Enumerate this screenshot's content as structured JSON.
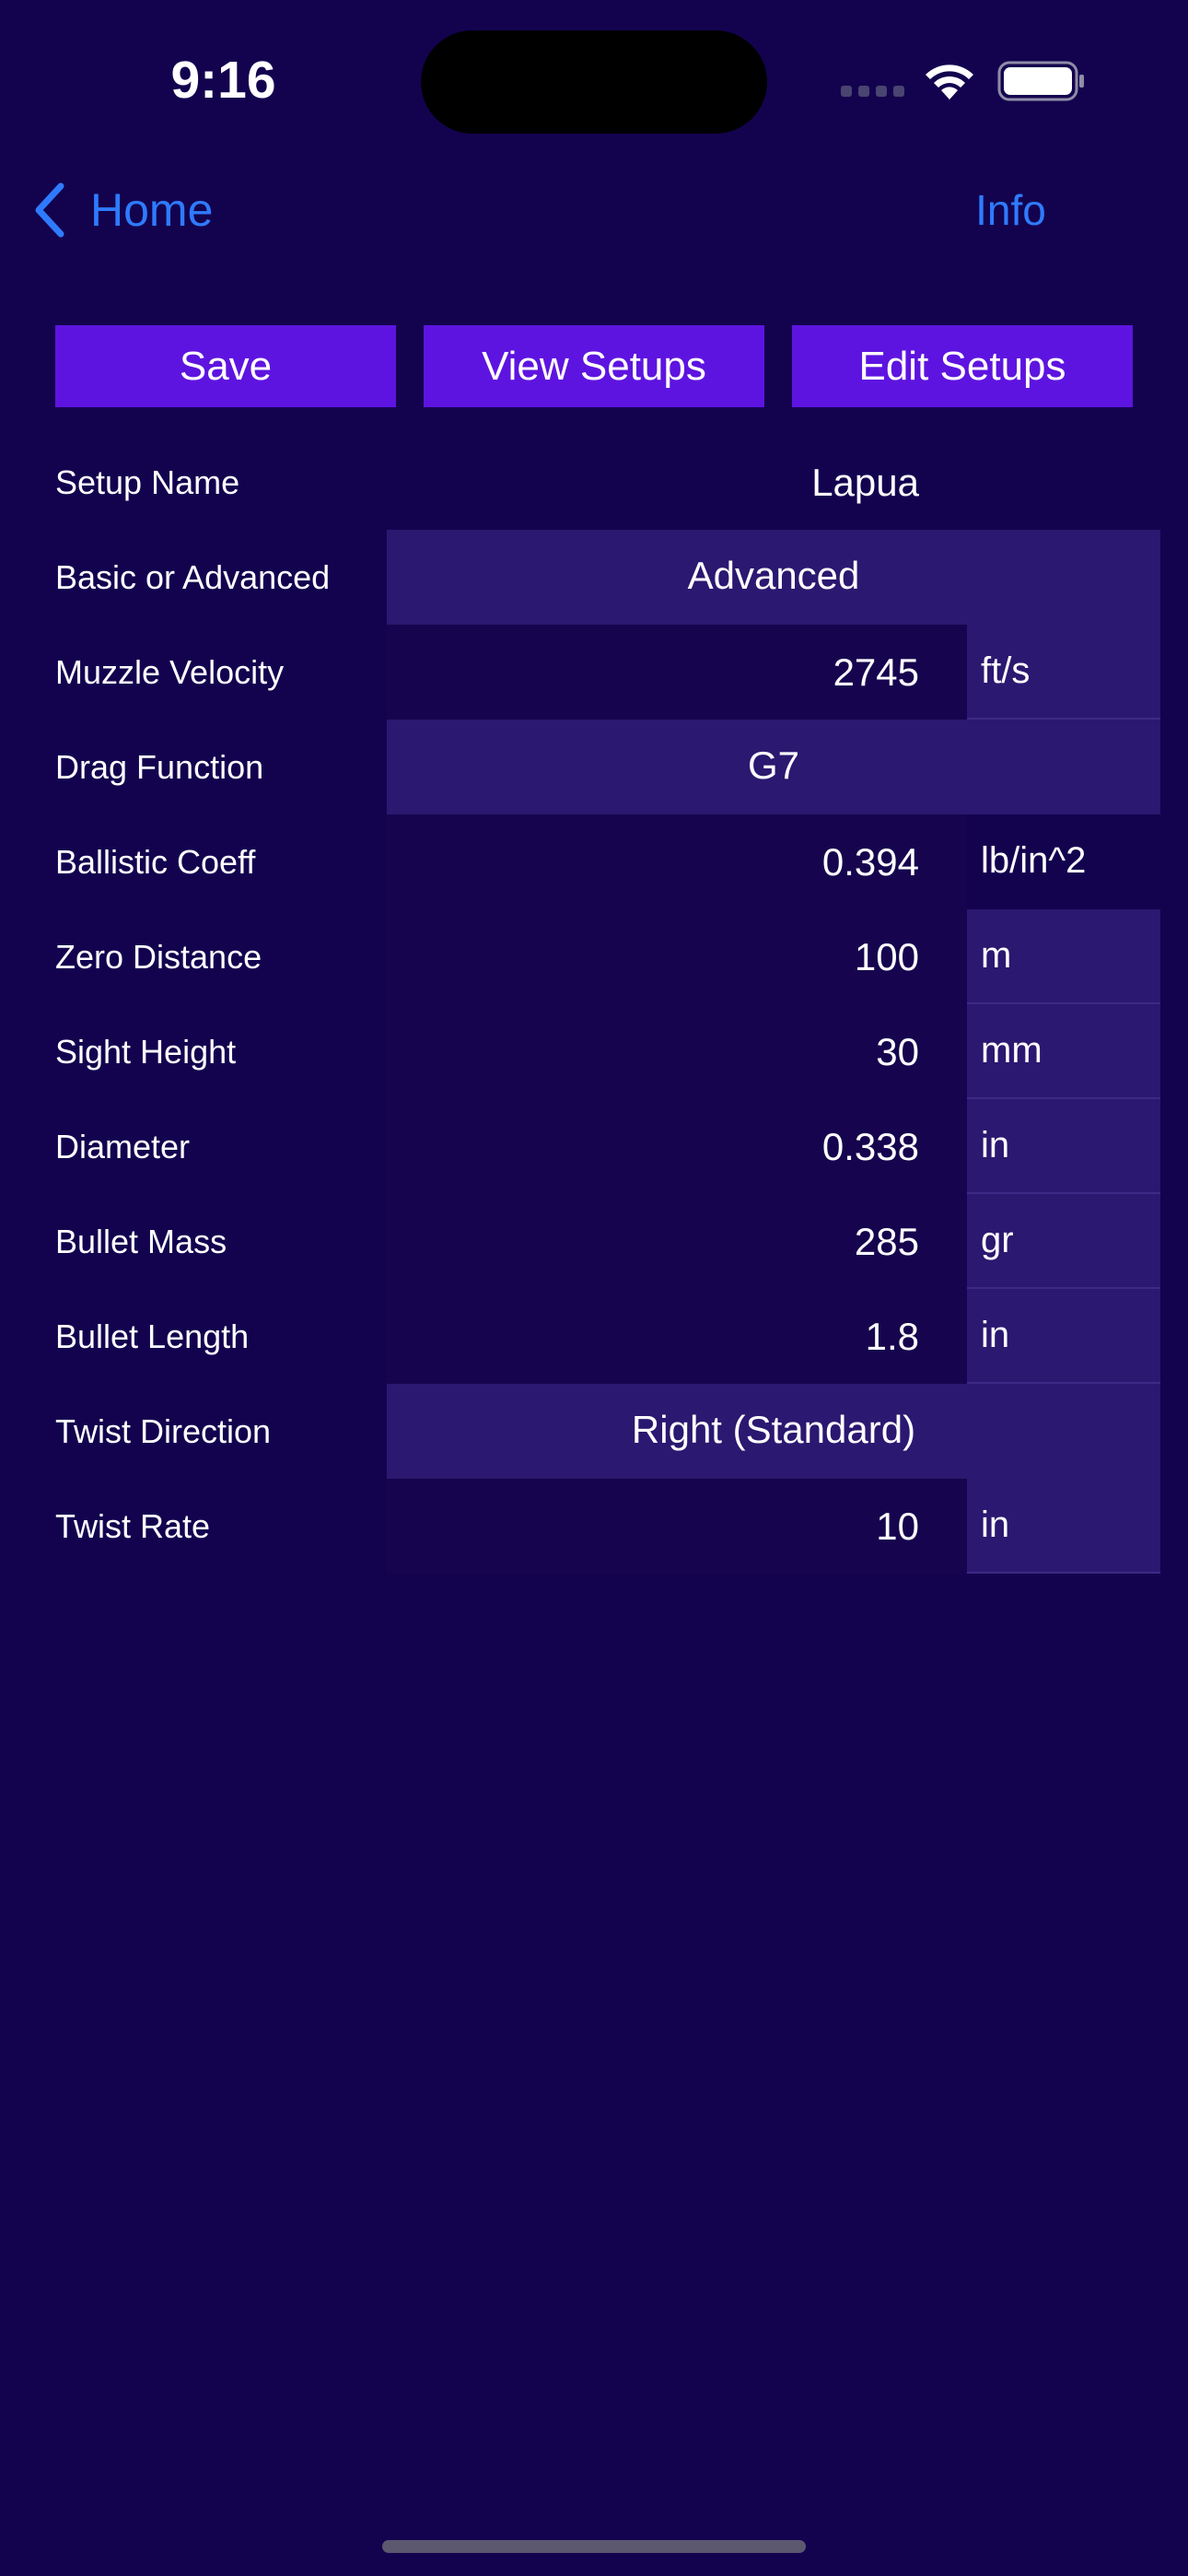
{
  "status_bar": {
    "time": "9:16"
  },
  "nav": {
    "back_label": "Home",
    "info_label": "Info"
  },
  "toolbar": {
    "save_label": "Save",
    "view_setups_label": "View Setups",
    "edit_setups_label": "Edit Setups"
  },
  "form": {
    "setup_name": {
      "label": "Setup Name",
      "value": "Lapua"
    },
    "basic_or_advanced": {
      "label": "Basic or Advanced",
      "value": "Advanced"
    },
    "muzzle_velocity": {
      "label": "Muzzle Velocity",
      "value": "2745",
      "unit": "ft/s"
    },
    "drag_function": {
      "label": "Drag Function",
      "value": "G7"
    },
    "ballistic_coeff": {
      "label": "Ballistic Coeff",
      "value": "0.394",
      "unit": "lb/in^2"
    },
    "zero_distance": {
      "label": "Zero Distance",
      "value": "100",
      "unit": "m"
    },
    "sight_height": {
      "label": "Sight Height",
      "value": "30",
      "unit": "mm"
    },
    "diameter": {
      "label": "Diameter",
      "value": "0.338",
      "unit": "in"
    },
    "bullet_mass": {
      "label": "Bullet Mass",
      "value": "285",
      "unit": "gr"
    },
    "bullet_length": {
      "label": "Bullet Length",
      "value": "1.8",
      "unit": "in"
    },
    "twist_direction": {
      "label": "Twist Direction",
      "value": "Right (Standard)"
    },
    "twist_rate": {
      "label": "Twist Rate",
      "value": "10",
      "unit": "in"
    }
  },
  "colors": {
    "background": "#13034f",
    "button": "#5e14e0",
    "link": "#2f7bff",
    "selector": "#2b1870",
    "field": "#16054e"
  }
}
